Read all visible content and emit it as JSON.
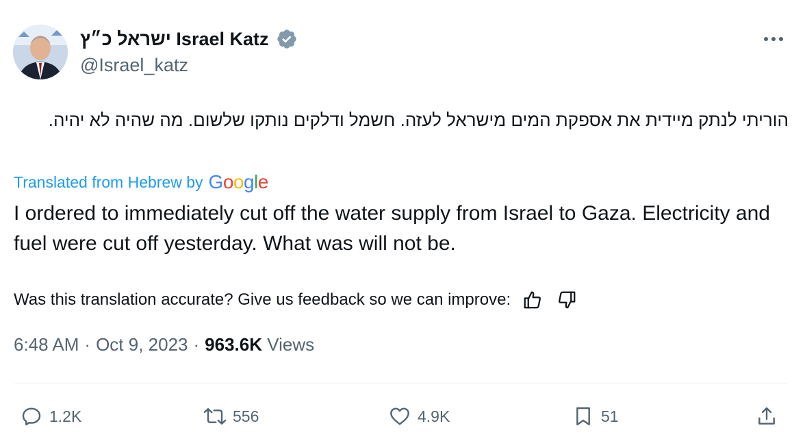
{
  "author": {
    "display_name": "ישראל כ״ץ Israel Katz",
    "handle": "@Israel_katz",
    "verified_color": "#829aab"
  },
  "tweet": {
    "text_hebrew": "הוריתי לנתק מיידית את אספקת המים מישראל לעזה. חשמל ודלקים נותקו שלשום. מה שהיה לא יהיה.",
    "translated_label": "Translated from Hebrew by",
    "google_logo_text": [
      "G",
      "o",
      "o",
      "g",
      "l",
      "e"
    ],
    "text_english": "I ordered to immediately cut off the water supply from Israel to Gaza. Electricity and fuel were cut off yesterday. What was will not be.",
    "feedback_prompt": "Was this translation accurate? Give us feedback so we can improve:",
    "time": "6:48 AM",
    "date": "Oct 9, 2023",
    "separator": "·",
    "views_count": "963.6K",
    "views_label": "Views"
  },
  "actions": {
    "replies": "1.2K",
    "retweets": "556",
    "likes": "4.9K",
    "bookmarks": "51"
  },
  "colors": {
    "link": "#1d9bf0",
    "secondary_text": "#536471",
    "primary_text": "#0f1419"
  }
}
